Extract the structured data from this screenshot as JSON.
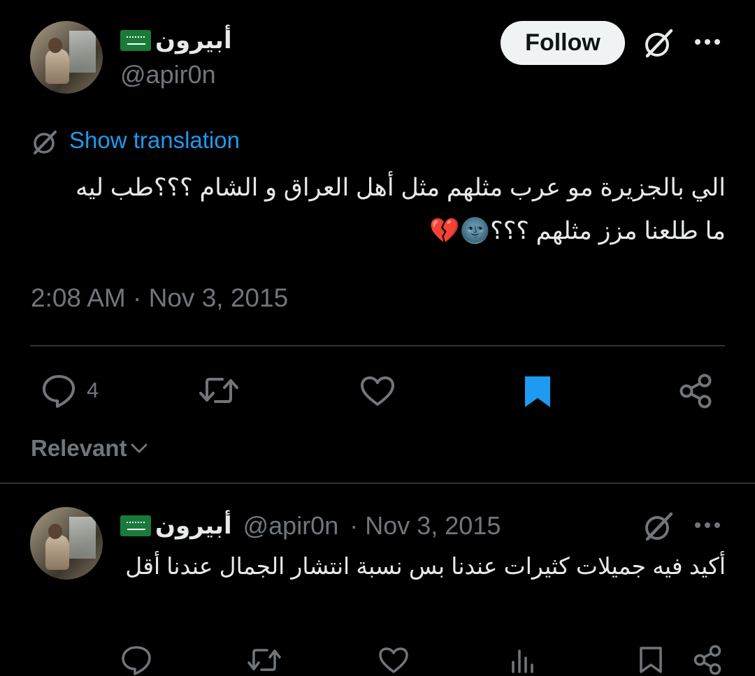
{
  "tweet": {
    "author": {
      "display_name": "أبيرون",
      "handle": "@apir0n",
      "flag_icon": "saudi-flag-icon"
    },
    "follow_label": "Follow",
    "translate_label": "Show translation",
    "text_line_1": "الي بالجزيرة مو عرب مثلهم مثل أهل العراق و الشام ؟؟؟طب ليه",
    "text_line_2": "ما طلعنا مزز مثلهم ؟؟؟🌚💔",
    "timestamp": "2:08 AM · Nov 3, 2015",
    "actions": {
      "reply_count": "4",
      "bookmark_color": "#1d9bf0"
    }
  },
  "replies_sort": {
    "label": "Relevant"
  },
  "reply": {
    "author": {
      "display_name": "أبيرون",
      "handle": "@apir0n",
      "date": "· Nov 3, 2015"
    },
    "text": "أكيد فيه جميلات كثيرات عندنا بس نسبة انتشار الجمال عندنا أقل"
  },
  "colors": {
    "background": "#000000",
    "text_primary": "#e7e9ea",
    "text_secondary": "#71767b",
    "accent": "#1d9bf0",
    "divider": "#2f3336"
  }
}
